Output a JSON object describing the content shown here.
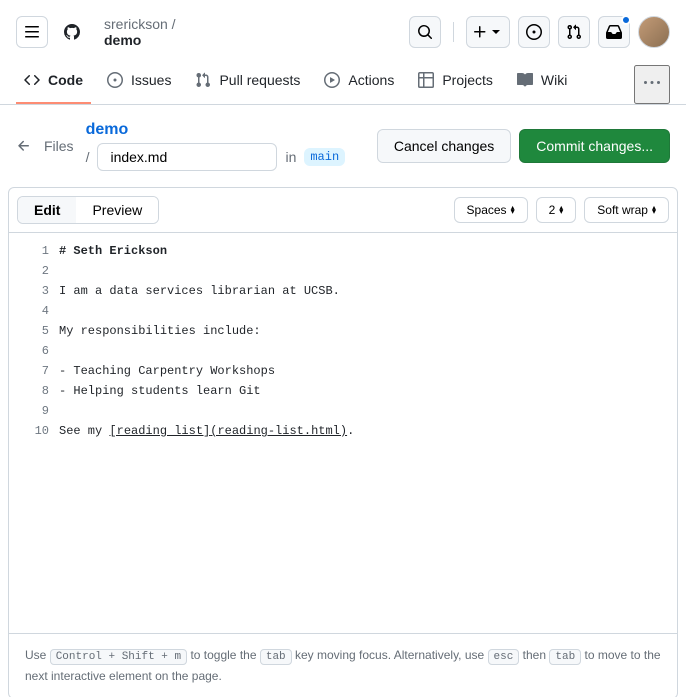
{
  "header": {
    "owner": "srerickson /",
    "repo": "demo"
  },
  "tabs": {
    "code": "Code",
    "issues": "Issues",
    "pulls": "Pull requests",
    "actions": "Actions",
    "projects": "Projects",
    "wiki": "Wiki"
  },
  "subheader": {
    "files": "Files",
    "repo_link": "demo",
    "filename": "index.md",
    "in": "in",
    "branch": "main",
    "cancel": "Cancel changes",
    "commit": "Commit changes..."
  },
  "toolbar": {
    "edit": "Edit",
    "preview": "Preview",
    "indent_mode": "Spaces",
    "indent_size": "2",
    "wrap": "Soft wrap"
  },
  "code": {
    "lines": [
      "# Seth Erickson",
      "",
      "I am a data services librarian at UCSB.",
      "",
      "My responsibilities include:",
      "",
      "- Teaching Carpentry Workshops",
      "- Helping students learn Git",
      "",
      "See my [reading list](reading-list.html)."
    ]
  },
  "footer": {
    "t1": "Use ",
    "k1": "Control + Shift + m",
    "t2": " to toggle the ",
    "k2": "tab",
    "t3": " key moving focus. Alternatively, use ",
    "k3": "esc",
    "t4": " then ",
    "k4": "tab",
    "t5": " to move to the next interactive element on the page."
  }
}
